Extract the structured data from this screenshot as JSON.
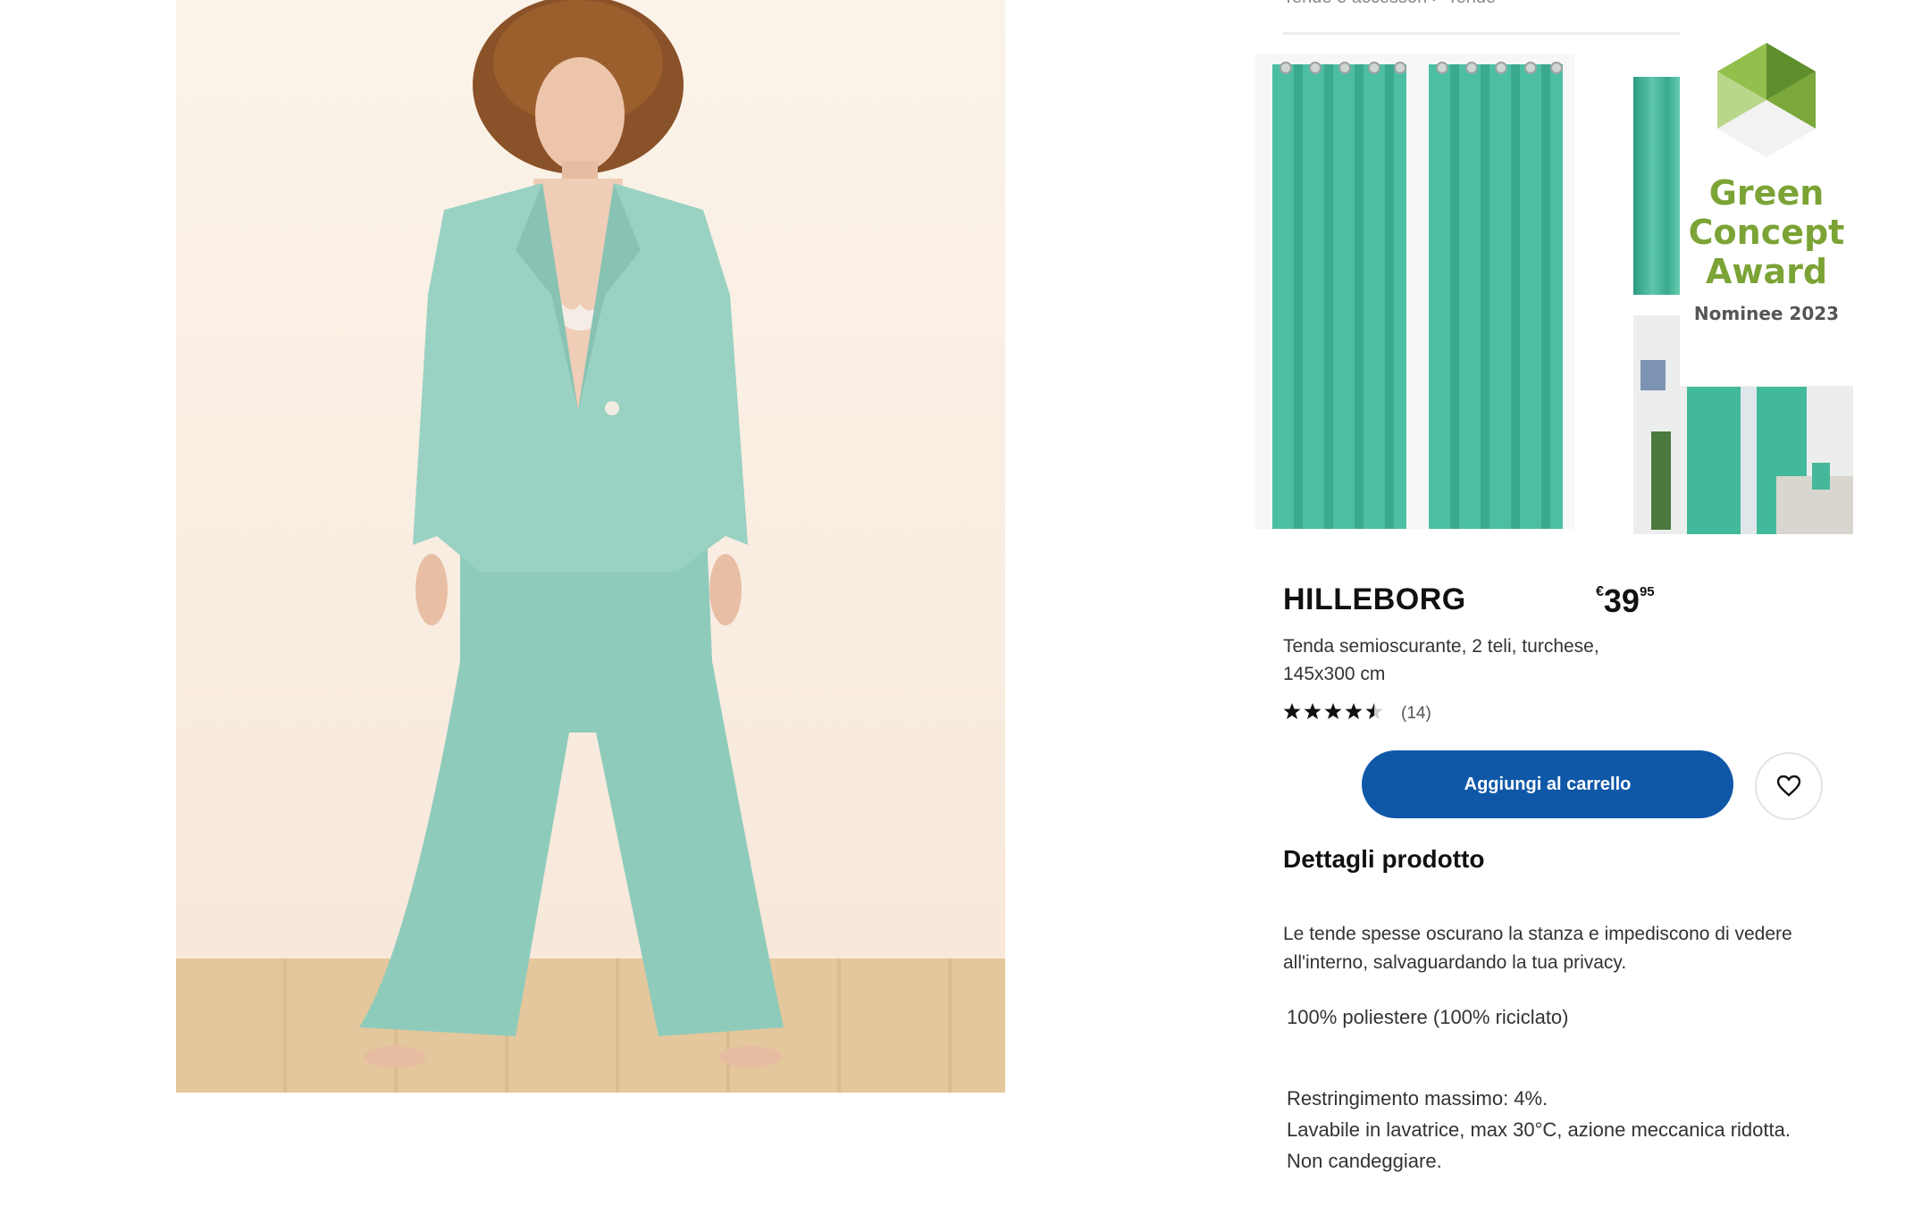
{
  "breadcrumb": {
    "text": "Tende e accessori  >  Tende"
  },
  "award": {
    "title": "Green Concept Award",
    "subtitle": "Nominee 2023"
  },
  "product": {
    "name": "HILLEBORG",
    "price": {
      "currency": "€",
      "integer": "39",
      "decimals": "95"
    },
    "description": "Tenda semioscurante, 2 teli, turchese, 145x300 cm",
    "rating": {
      "stars": 4.5,
      "count_label": "(14)"
    },
    "add_to_cart_label": "Aggiungi al carrello"
  },
  "details": {
    "heading": "Dettagli prodotto",
    "text": "Le tende spesse oscurano la stanza e impediscono di vedere all'interno, salvaguardando la tua privacy.",
    "material": "100% poliestere (100% riciclato)",
    "care": [
      "Restringimento massimo: 4%.",
      "Lavabile in lavatrice, max 30°C, azione meccanica ridotta.",
      "Non candeggiare."
    ]
  },
  "colors": {
    "accent_blue": "#0f58a8",
    "curtain_turquoise": "#4cbfa3",
    "award_green": "#7ba335"
  },
  "icons": {
    "favourite": "heart-icon",
    "rating": "star-icon"
  }
}
